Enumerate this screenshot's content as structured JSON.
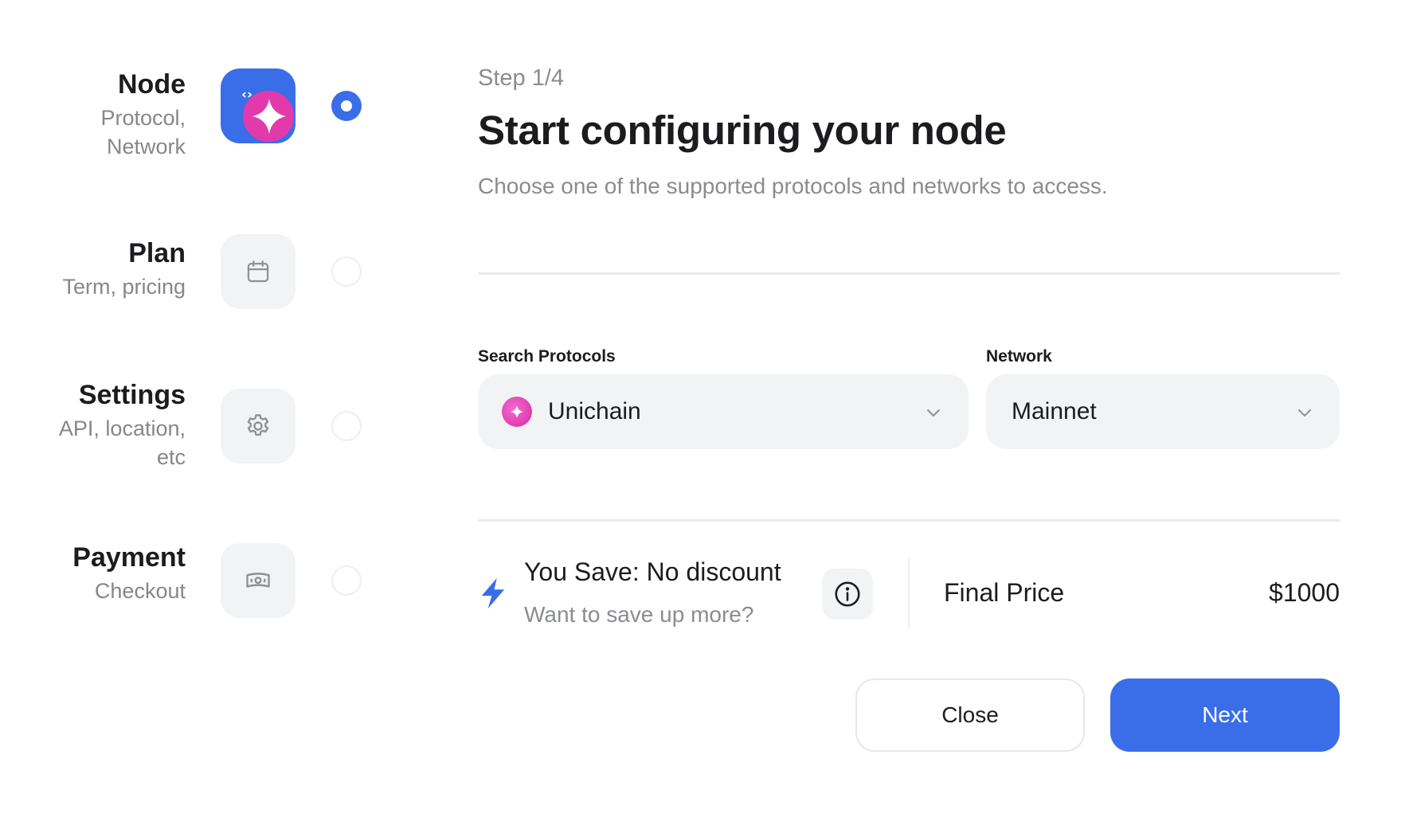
{
  "steps": [
    {
      "title": "Node",
      "subtitle": "Protocol,\nNetwork",
      "icon": "node-icon",
      "active": true
    },
    {
      "title": "Plan",
      "subtitle": "Term, pricing",
      "icon": "calendar-icon",
      "active": false
    },
    {
      "title": "Settings",
      "subtitle": "API, location,\netc",
      "icon": "gear-icon",
      "active": false
    },
    {
      "title": "Payment",
      "subtitle": "Checkout",
      "icon": "money-icon",
      "active": false
    }
  ],
  "main": {
    "step_count": "Step 1/4",
    "title": "Start configuring your node",
    "description": "Choose one of the supported protocols and networks to access."
  },
  "protocol": {
    "label": "Search Protocols",
    "value": "Unichain",
    "icon": "unichain-icon"
  },
  "network": {
    "label": "Network",
    "value": "Mainnet"
  },
  "savings": {
    "title": "You Save: No discount",
    "subtitle": "Want to save up more?",
    "final_label": "Final Price",
    "final_value": "$1000"
  },
  "buttons": {
    "close": "Close",
    "next": "Next"
  },
  "colors": {
    "accent": "#3a6ee8",
    "brand_pink": "#e03aa8",
    "muted": "#8a8c91"
  }
}
